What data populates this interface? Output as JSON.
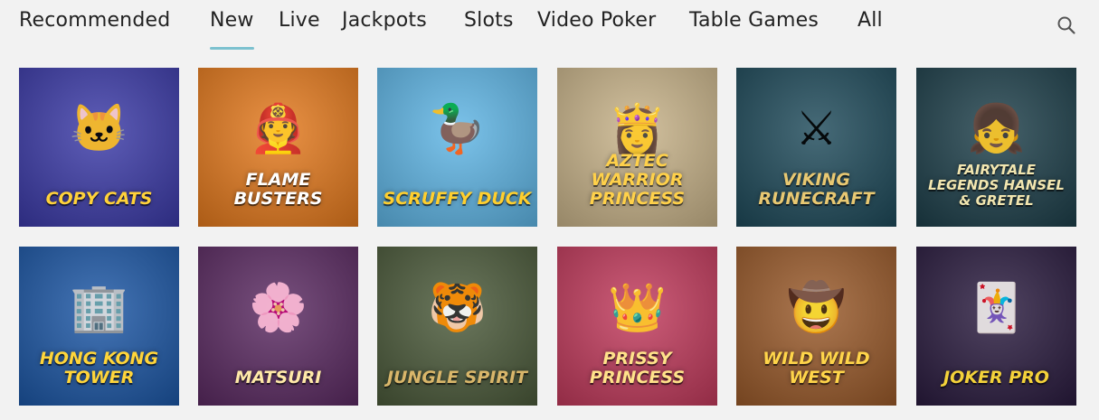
{
  "nav": {
    "tabs": [
      {
        "label": "Recommended",
        "active": false
      },
      {
        "label": "New",
        "active": true
      },
      {
        "label": "Live",
        "active": false
      },
      {
        "label": "Jackpots",
        "active": false
      },
      {
        "label": "Slots",
        "active": false
      },
      {
        "label": "Video Poker",
        "active": false
      },
      {
        "label": "Table Games",
        "active": false
      },
      {
        "label": "All",
        "active": false
      }
    ],
    "search_icon": "search-icon",
    "accent": "#7cc1cf"
  },
  "games": [
    {
      "title": "Copy Cats",
      "icon": "cat-icon",
      "bg": "#3b3aa8",
      "text": "#ffd23a"
    },
    {
      "title": "Flame Busters",
      "icon": "firefighter-icon",
      "bg": "#e57a1d",
      "text": "#ffffff"
    },
    {
      "title": "Scruffy Duck",
      "icon": "duck-icon",
      "bg": "#5fb6e6",
      "text": "#ffcf2e"
    },
    {
      "title": "Aztec Warrior Princess",
      "icon": "aztec-mask-icon",
      "bg": "#c9b48a",
      "text": "#ffd14a"
    },
    {
      "title": "Viking Runecraft",
      "icon": "viking-icon",
      "bg": "#1e4a5a",
      "text": "#e8c872"
    },
    {
      "title": "Fairytale Legends Hansel & Gretel",
      "icon": "children-icon",
      "bg": "#1d3f4a",
      "text": "#f2e6b0"
    },
    {
      "title": "Hong Kong Tower",
      "icon": "tower-icon",
      "bg": "#1c57a6",
      "text": "#ffd53a"
    },
    {
      "title": "Matsuri",
      "icon": "geisha-icon",
      "bg": "#5b2a62",
      "text": "#ffe9a8"
    },
    {
      "title": "Jungle Spirit",
      "icon": "tiger-icon",
      "bg": "#4b5a3a",
      "text": "#d9b66a"
    },
    {
      "title": "Prissy Princess",
      "icon": "princess-icon",
      "bg": "#c23a5c",
      "text": "#ffe28a"
    },
    {
      "title": "Wild Wild West",
      "icon": "cowboys-icon",
      "bg": "#9a5a2a",
      "text": "#ffd54a"
    },
    {
      "title": "Joker Pro",
      "icon": "jester-hat-icon",
      "bg": "#2a1b3f",
      "text": "#f4d23a"
    }
  ]
}
